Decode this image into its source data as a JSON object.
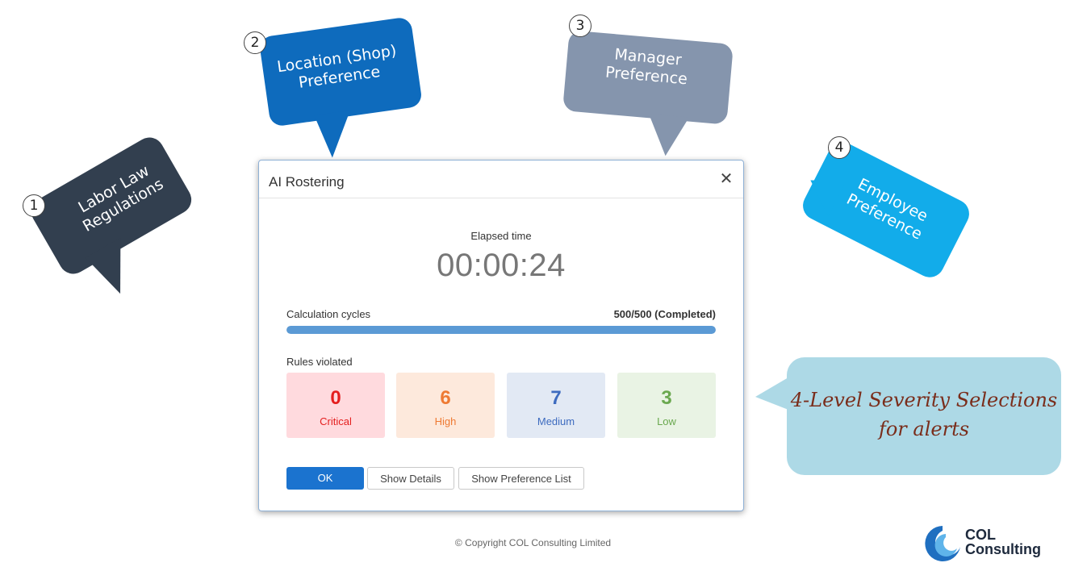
{
  "callouts": [
    {
      "badge": "1",
      "line1": "Labor Law",
      "line2": "Regulations",
      "color": "#323f4f"
    },
    {
      "badge": "2",
      "line1": "Location (Shop)",
      "line2": "Preference",
      "color": "#0e6bbd"
    },
    {
      "badge": "3",
      "line1": "Manager",
      "line2": "Preference",
      "color": "#8595ad"
    },
    {
      "badge": "4",
      "line1": "Employee",
      "line2": "Preference",
      "color": "#12acea"
    }
  ],
  "severity_callout": {
    "line1": "4-Level Severity Selections",
    "line2": "for alerts",
    "color": "#add9e6"
  },
  "dialog": {
    "title": "AI Rostering",
    "elapsed_label": "Elapsed time",
    "elapsed_value": "00:00:24",
    "cycles_label": "Calculation cycles",
    "cycles_value": "500/500 (Completed)",
    "progress": 1.0,
    "rules_label": "Rules violated",
    "rules": [
      {
        "count": "0",
        "label": "Critical",
        "bg": "#ffdade",
        "fg": "#e41e1e"
      },
      {
        "count": "6",
        "label": "High",
        "bg": "#fde9dc",
        "fg": "#ee7a33"
      },
      {
        "count": "7",
        "label": "Medium",
        "bg": "#e2e9f4",
        "fg": "#3d6bbf"
      },
      {
        "count": "3",
        "label": "Low",
        "bg": "#e9f3e4",
        "fg": "#6aa84f"
      }
    ],
    "buttons": {
      "ok": "OK",
      "details": "Show Details",
      "preference": "Show Preference List"
    }
  },
  "copyright": "© Copyright COL Consulting Limited",
  "logo": {
    "line1": "COL",
    "line2": "Consulting"
  }
}
